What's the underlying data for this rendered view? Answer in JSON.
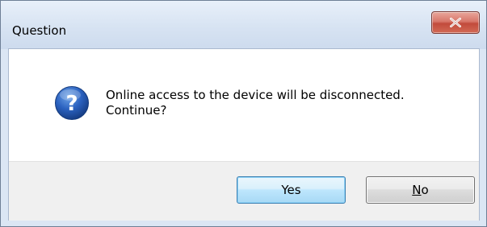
{
  "window": {
    "title": "Question",
    "close_icon": "close-icon"
  },
  "message": {
    "icon": "question-icon",
    "line1": "Online access to the device will be disconnected.",
    "line2": "Continue?"
  },
  "buttons": {
    "yes_label": "Yes",
    "no_mnemonic": "N",
    "no_rest": "o"
  },
  "colors": {
    "close_button": "#c24b3c",
    "default_button_border": "#3c7fb1",
    "question_icon": "#1f4fa0"
  }
}
